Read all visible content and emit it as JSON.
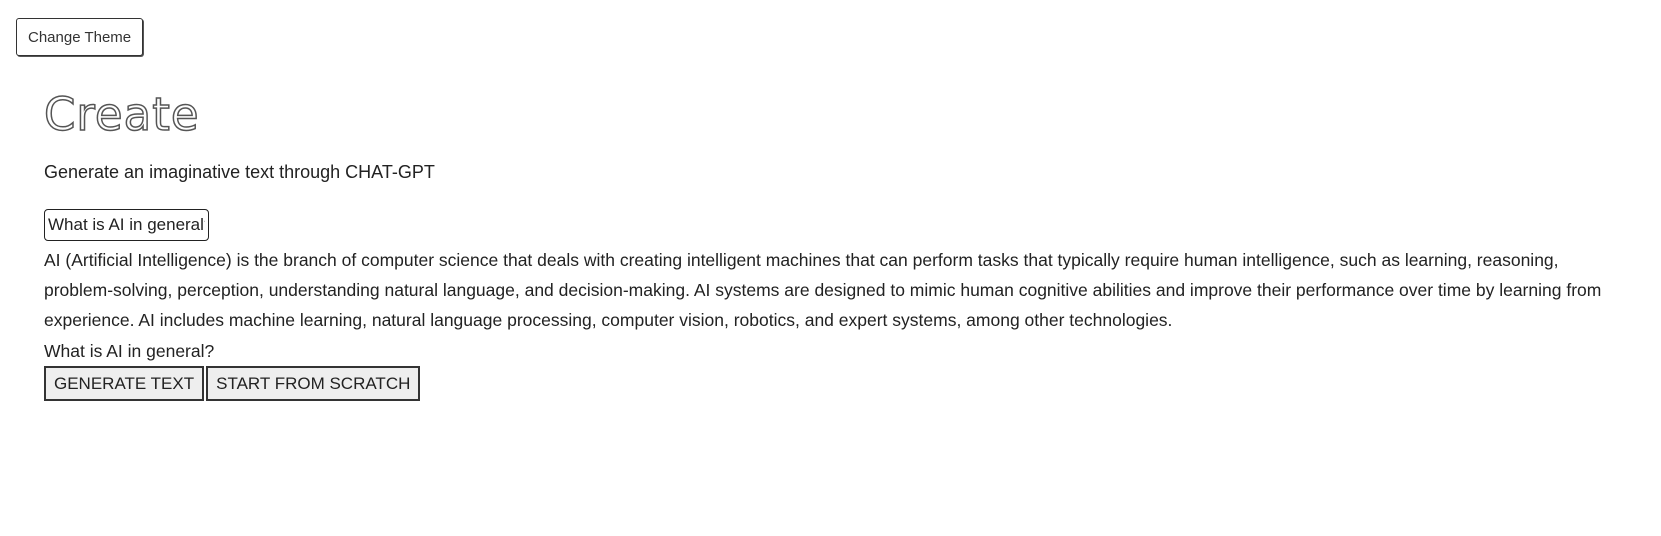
{
  "header": {
    "theme_button_label": "Change Theme"
  },
  "main": {
    "title": "Create",
    "subtitle": "Generate an imaginative text through CHAT-GPT",
    "prompt_input_value": "What is AI in general?",
    "response": "AI (Artificial Intelligence) is the branch of computer science that deals with creating intelligent machines that can perform tasks that typically require human intelligence, such as learning, reasoning, problem-solving, perception, understanding natural language, and decision-making. AI systems are designed to mimic human cognitive abilities and improve their performance over time by learning from experience. AI includes machine learning, natural language processing, computer vision, robotics, and expert systems, among other technologies.",
    "prompt_echo": "What is AI in general?",
    "generate_button_label": "GENERATE TEXT",
    "scratch_button_label": "START FROM SCRATCH"
  }
}
